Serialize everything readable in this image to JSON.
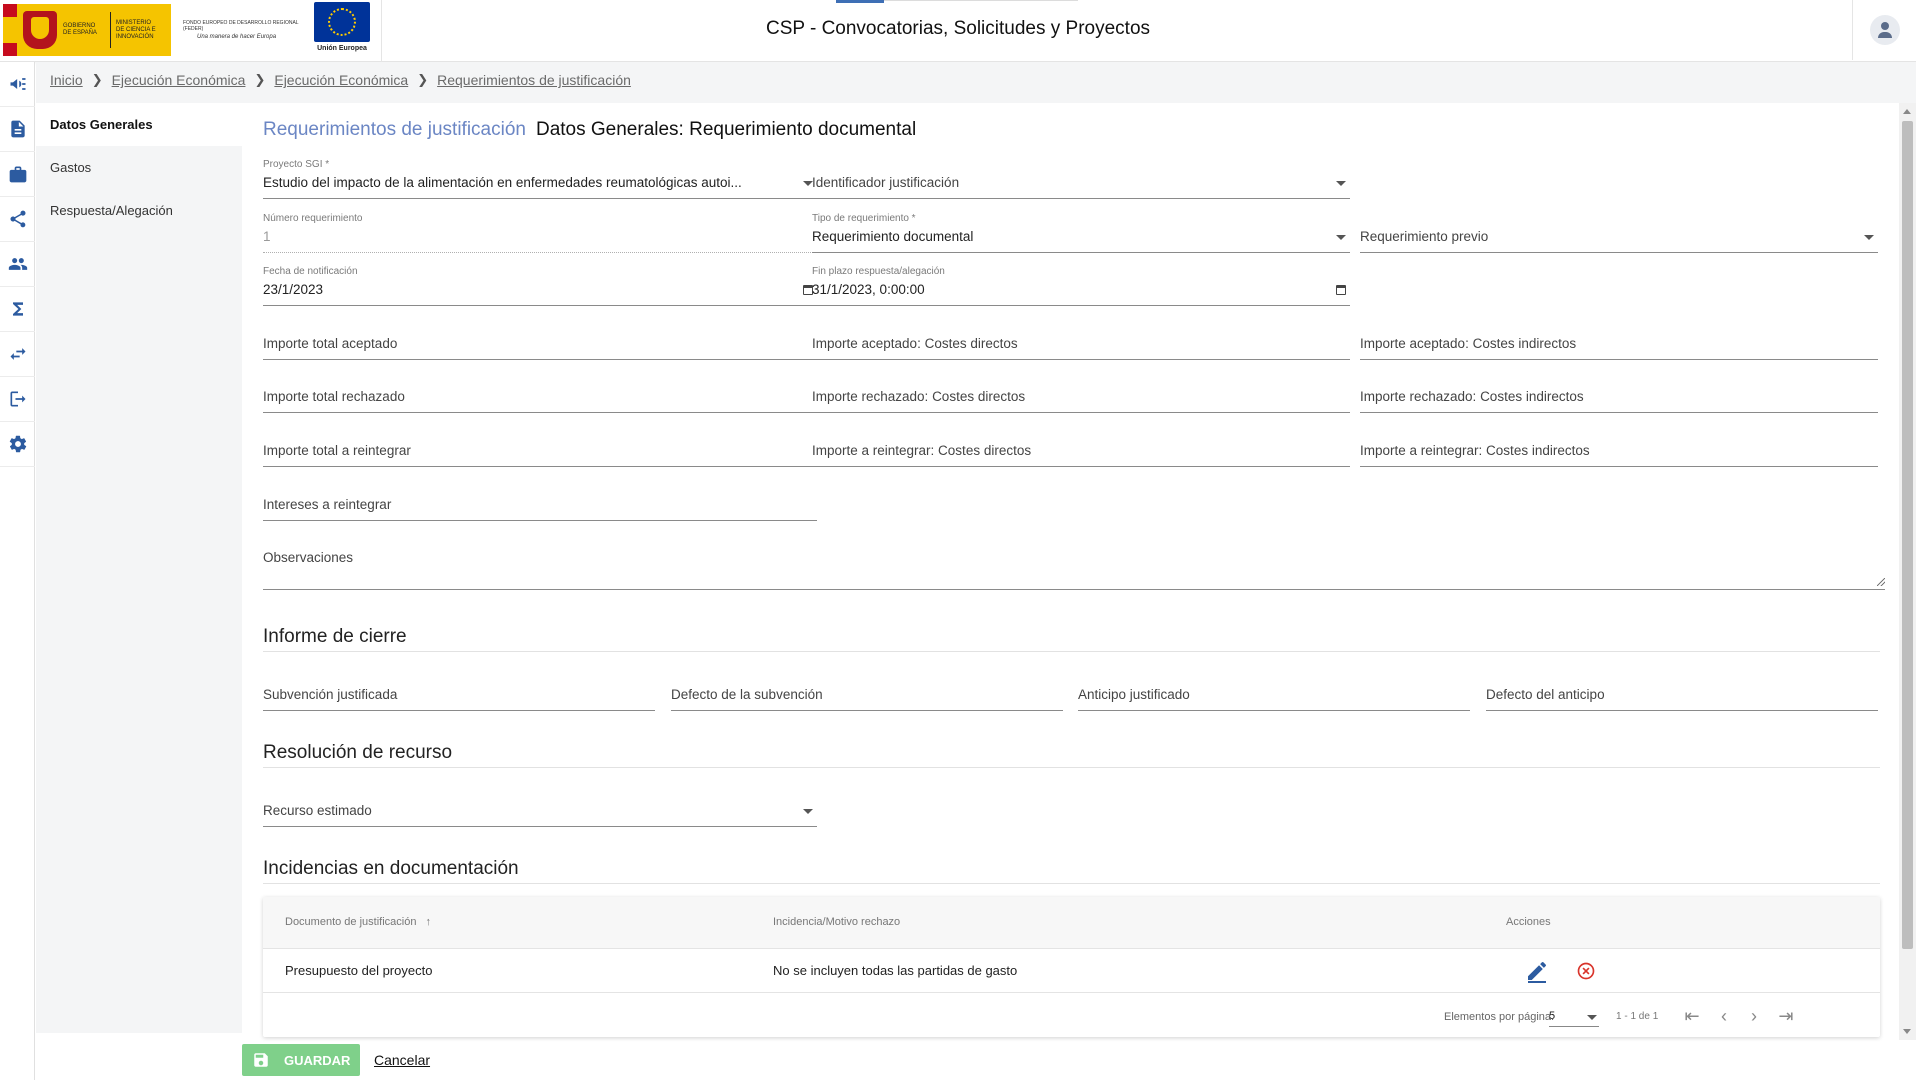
{
  "header": {
    "logo_gob_text": "GOBIERNO DE ESPAÑA",
    "logo_ministerio_text": "MINISTERIO DE CIENCIA E INNOVACIÓN",
    "logo_feder_line1": "FONDO EUROPEO DE DESARROLLO REGIONAL (FEDER)",
    "logo_feder_line2": "Una manera de hacer Europa",
    "logo_eu_text": "Unión Europea",
    "app_title": "CSP - Convocatorias, Solicitudes y Proyectos"
  },
  "breadcrumb": [
    "Inicio",
    "Ejecución Económica",
    "Ejecución Económica",
    "Requerimientos de justificación"
  ],
  "section_nav": [
    "Datos Generales",
    "Gastos",
    "Respuesta/Alegación"
  ],
  "page": {
    "title": "Requerimientos de justificación",
    "subtitle": "Datos Generales: Requerimiento documental"
  },
  "form": {
    "proyecto_sgi": {
      "label": "Proyecto SGI *",
      "value": "Estudio del impacto de la alimentación en enfermedades reumatológicas autoi..."
    },
    "identificador_justificacion": {
      "placeholder": "Identificador justificación"
    },
    "numero_requerimiento": {
      "label": "Número requerimiento",
      "value": "1"
    },
    "tipo_requerimiento": {
      "label": "Tipo de requerimiento *",
      "value": "Requerimiento documental"
    },
    "requerimiento_previo": {
      "placeholder": "Requerimiento previo"
    },
    "fecha_notificacion": {
      "label": "Fecha de notificación",
      "value": "23/1/2023"
    },
    "fin_plazo": {
      "label": "Fin plazo respuesta/alegación",
      "value": "31/1/2023, 0:00:00"
    },
    "importe_total_aceptado": "Importe total aceptado",
    "importe_aceptado_directos": "Importe aceptado: Costes directos",
    "importe_aceptado_indirectos": "Importe aceptado: Costes indirectos",
    "importe_total_rechazado": "Importe total rechazado",
    "importe_rechazado_directos": "Importe rechazado: Costes directos",
    "importe_rechazado_indirectos": "Importe rechazado: Costes indirectos",
    "importe_total_reintegrar": "Importe total a reintegrar",
    "importe_reintegrar_directos": "Importe a reintegrar: Costes directos",
    "importe_reintegrar_indirectos": "Importe a reintegrar: Costes indirectos",
    "intereses_reintegrar": "Intereses a reintegrar",
    "observaciones": "Observaciones"
  },
  "informe_cierre": {
    "title": "Informe de cierre",
    "subvencion_justificada": "Subvención justificada",
    "defecto_subvencion": "Defecto de la subvención",
    "anticipo_justificado": "Anticipo justificado",
    "defecto_anticipo": "Defecto del anticipo"
  },
  "resolucion": {
    "title": "Resolución de recurso",
    "recurso_estimado": "Recurso estimado"
  },
  "incidencias": {
    "title": "Incidencias en documentación",
    "columns": [
      "Documento de justificación",
      "Incidencia/Motivo rechazo",
      "Acciones"
    ],
    "rows": [
      {
        "documento": "Presupuesto del proyecto",
        "incidencia": "No se incluyen todas las partidas de gasto"
      }
    ],
    "paginator": {
      "items_per_page_label": "Elementos por página:",
      "items_per_page": "5",
      "range": "1 - 1 de 1"
    }
  },
  "actions": {
    "save": "GUARDAR",
    "cancel": "Cancelar"
  },
  "colors": {
    "primary": "#2c5ba0",
    "title_accent": "#6b86c4",
    "save_button": "#7fd08a",
    "delete_icon": "#d9342b"
  },
  "icons": {
    "rail": [
      "megaphone-icon",
      "document-icon",
      "briefcase-icon",
      "share-icon",
      "people-icon",
      "sigma-icon",
      "swap-icon",
      "exit-icon",
      "gear-icon"
    ],
    "header_user": "user-icon",
    "edit": "pencil-icon",
    "delete": "close-circle-icon",
    "save": "floppy-icon"
  }
}
